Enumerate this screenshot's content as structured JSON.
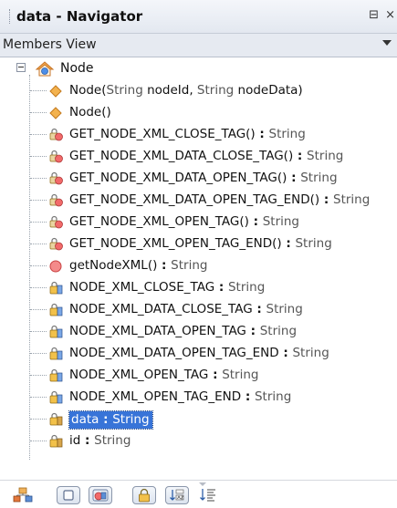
{
  "window": {
    "title": "data - Navigator",
    "minimize_label": "⊟",
    "close_label": "×"
  },
  "view_selector": {
    "selected": "Members View"
  },
  "tree": {
    "root": {
      "label": "Node"
    },
    "items": [
      {
        "kind": "constructor",
        "name": "Node(",
        "type": "String",
        "name2": " nodeId, ",
        "type2": "String",
        "name3": " nodeData)"
      },
      {
        "kind": "constructor",
        "name": "Node()"
      },
      {
        "kind": "method-static",
        "name": "GET_NODE_XML_CLOSE_TAG()",
        "sep": " : ",
        "type": "String"
      },
      {
        "kind": "method-static",
        "name": "GET_NODE_XML_DATA_CLOSE_TAG()",
        "sep": " : ",
        "type": "String"
      },
      {
        "kind": "method-static",
        "name": "GET_NODE_XML_DATA_OPEN_TAG()",
        "sep": " : ",
        "type": "String"
      },
      {
        "kind": "method-static",
        "name": "GET_NODE_XML_DATA_OPEN_TAG_END()",
        "sep": " : ",
        "type": "String"
      },
      {
        "kind": "method-static",
        "name": "GET_NODE_XML_OPEN_TAG()",
        "sep": " : ",
        "type": "String"
      },
      {
        "kind": "method-static",
        "name": "GET_NODE_XML_OPEN_TAG_END()",
        "sep": " : ",
        "type": "String"
      },
      {
        "kind": "method",
        "name": "getNodeXML()",
        "sep": " : ",
        "type": "String"
      },
      {
        "kind": "field-static",
        "name": "NODE_XML_CLOSE_TAG",
        "sep": " : ",
        "type": "String"
      },
      {
        "kind": "field-static",
        "name": "NODE_XML_DATA_CLOSE_TAG",
        "sep": " : ",
        "type": "String"
      },
      {
        "kind": "field-static",
        "name": "NODE_XML_DATA_OPEN_TAG",
        "sep": " : ",
        "type": "String"
      },
      {
        "kind": "field-static",
        "name": "NODE_XML_DATA_OPEN_TAG_END",
        "sep": " : ",
        "type": "String"
      },
      {
        "kind": "field-static",
        "name": "NODE_XML_OPEN_TAG",
        "sep": " : ",
        "type": "String"
      },
      {
        "kind": "field-static",
        "name": "NODE_XML_OPEN_TAG_END",
        "sep": " : ",
        "type": "String"
      },
      {
        "kind": "field",
        "name": "data",
        "sep": " : ",
        "type": "String",
        "selected": true
      },
      {
        "kind": "field",
        "name": "id",
        "sep": " : ",
        "type": "String"
      }
    ]
  },
  "toolbar": {
    "buttons": [
      {
        "icon": "hierarchy-icon",
        "toggle": false
      },
      {
        "icon": "show-fields-icon",
        "toggle": true
      },
      {
        "icon": "show-static-icon",
        "toggle": true
      },
      {
        "icon": "show-non-public-icon",
        "toggle": true
      },
      {
        "icon": "sort-by-name-icon",
        "toggle": true
      },
      {
        "icon": "sort-by-source-icon",
        "toggle": false
      }
    ]
  },
  "colors": {
    "selection": "#3874d8",
    "constructor": "#e8a13a",
    "method": "#f26a6a",
    "field": "#c89a3a"
  }
}
